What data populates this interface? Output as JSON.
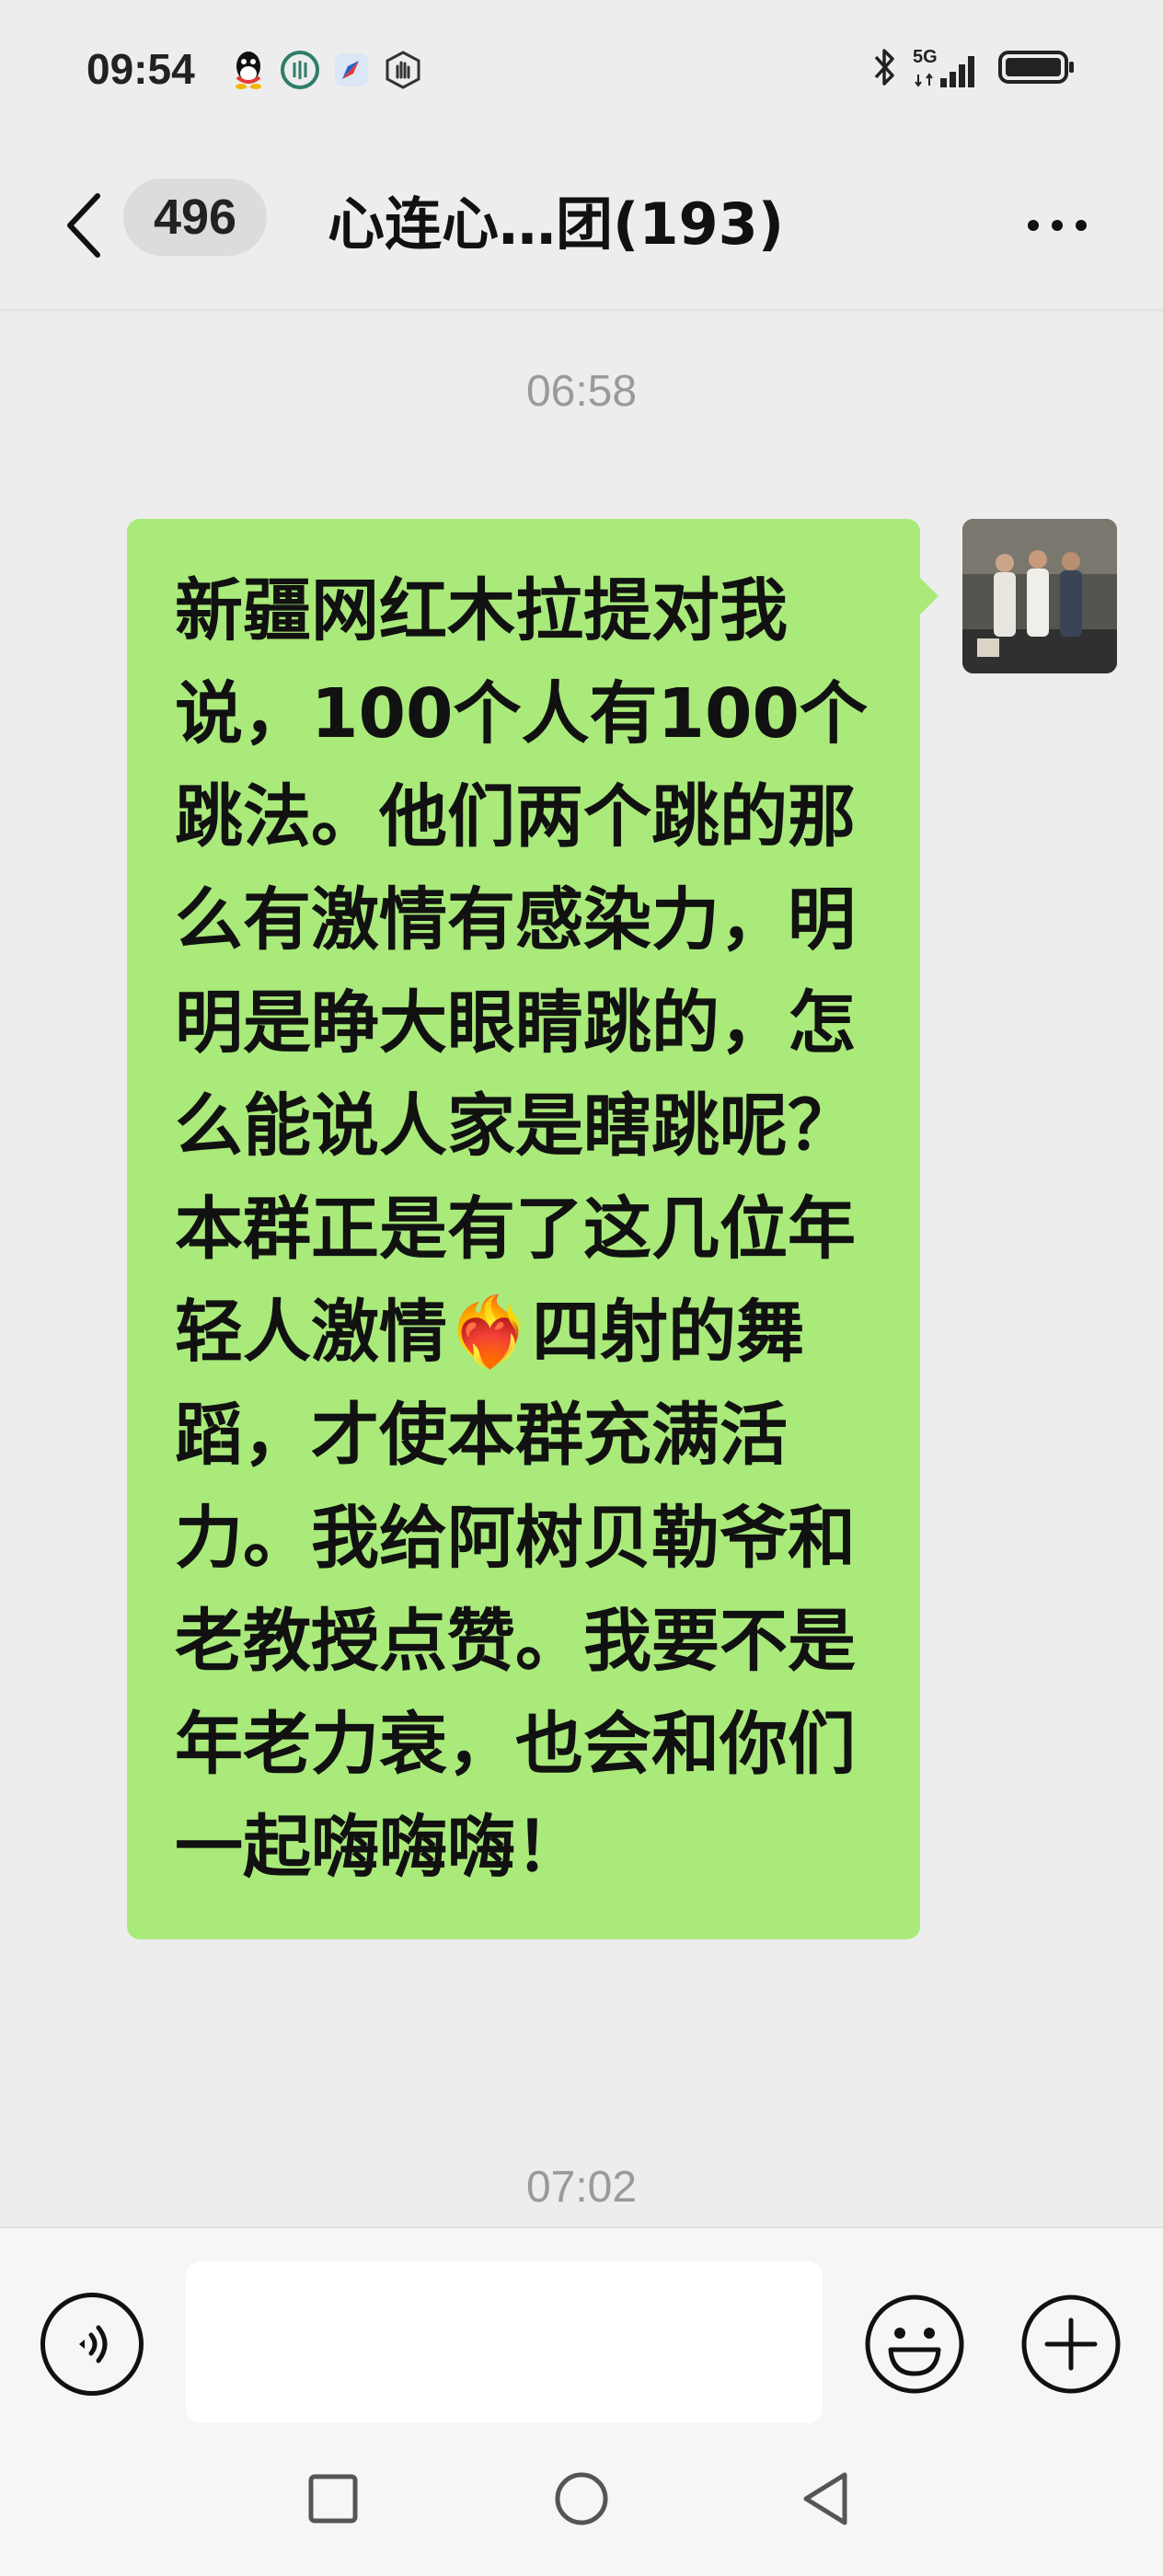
{
  "status_bar": {
    "time": "09:54",
    "left_icons": [
      "qq-icon",
      "app-icon",
      "compass-icon",
      "shield-hand-icon"
    ],
    "right_icons": [
      "bluetooth-icon",
      "signal-5g-icon",
      "battery-icon"
    ],
    "network_label": "5G"
  },
  "header": {
    "unread_count": "496",
    "title": "心连心…团(193)"
  },
  "messages": [
    {
      "time": "06:58",
      "text": "新疆网红木拉提对我说，100个人有100个跳法。他们两个跳的那么有激情有感染力，明明是睁大眼睛跳的，怎么能说人家是瞎跳呢？本群正是有了这几位年轻人激情❤️‍🔥四射的舞蹈，才使本群充满活力。我给阿树贝勒爷和老教授点赞。我要不是年老力衰，也会和你们一起嗨嗨嗨！",
      "sender_avatar": "avatar-photo"
    }
  ],
  "next_time": "07:02",
  "input": {
    "value": "",
    "placeholder": ""
  },
  "colors": {
    "background": "#ededed",
    "bubble": "#a9ea7a",
    "input_bar": "#f6f6f6"
  }
}
